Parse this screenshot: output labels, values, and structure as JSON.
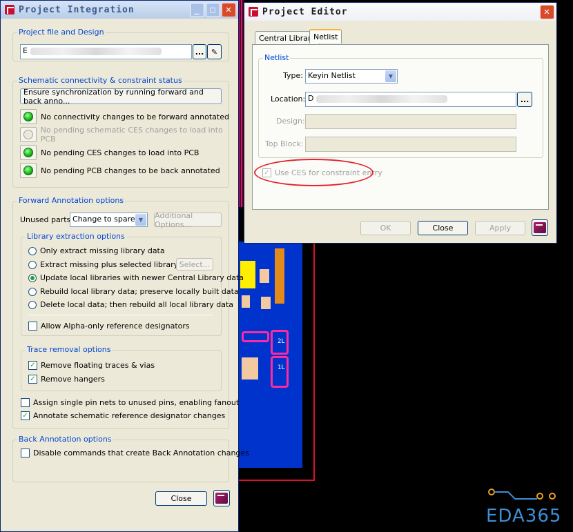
{
  "project_integration": {
    "title": "Project Integration",
    "project_file_group": "Project file and Design",
    "project_file_value": "E",
    "browse_label": "...",
    "schematic_group": "Schematic connectivity & constraint status",
    "sync_button": "Ensure synchronization by running forward and back anno...",
    "status_items": [
      {
        "text": "No connectivity changes to be forward annotated",
        "state": "on"
      },
      {
        "text": "No pending schematic CES changes to load into PCB",
        "state": "off"
      },
      {
        "text": "No pending CES changes to load into PCB",
        "state": "on"
      },
      {
        "text": "No pending PCB changes to be back annotated",
        "state": "on"
      }
    ],
    "forward_group": "Forward Annotation options",
    "unused_parts_label": "Unused parts:",
    "unused_parts_value": "Change to spares",
    "additional_options": "Additional Options...",
    "library_group": "Library extraction options",
    "library_options": [
      {
        "text": "Only extract missing library data",
        "checked": false
      },
      {
        "text": "Extract missing plus selected library data",
        "checked": false
      },
      {
        "text": "Update local libraries with newer Central Library data",
        "checked": true
      },
      {
        "text": "Rebuild local library data; preserve locally built data",
        "checked": false
      },
      {
        "text": "Delete local data; then rebuild all local library data",
        "checked": false
      }
    ],
    "select_button": "Select...",
    "alpha_only": "Allow Alpha-only reference designators",
    "trace_group": "Trace removal options",
    "remove_floating": "Remove floating traces & vias",
    "remove_hangers": "Remove hangers",
    "assign_single_pin": "Assign single pin nets to unused pins, enabling fanout",
    "annotate_schematic": "Annotate schematic reference designator changes",
    "back_group": "Back Annotation options",
    "disable_back": "Disable commands that create Back Annotation changes",
    "close_button": "Close"
  },
  "project_editor": {
    "title": "Project Editor",
    "tabs": [
      "Central Library",
      "Netlist"
    ],
    "netlist_group": "Netlist",
    "type_label": "Type:",
    "type_value": "Keyin Netlist",
    "location_label": "Location:",
    "location_value": "D",
    "browse_label": "...",
    "design_label": "Design:",
    "top_block_label": "Top Block:",
    "use_ces": "Use CES for constraint entry",
    "ok_button": "OK",
    "close_button": "Close",
    "apply_button": "Apply"
  },
  "pcb_labels": [
    "2L",
    "1L"
  ],
  "watermark": {
    "text": "EDA365"
  },
  "colors": {
    "accent": "#0046d5",
    "led_on": "#12b512",
    "annotation": "#e3232e"
  }
}
